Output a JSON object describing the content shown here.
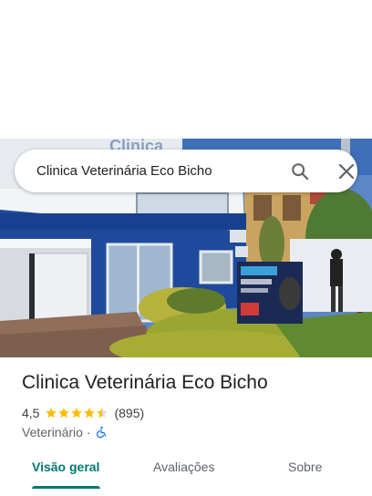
{
  "search": {
    "query": "Clinica Veterinária Eco Bicho"
  },
  "place": {
    "name": "Clinica Veterinária Eco Bicho",
    "rating": "4,5",
    "stars": 4.5,
    "review_count": "(895)",
    "category": "Veterinário",
    "separator": "·",
    "accessibility": "wheelchair-accessible-icon"
  },
  "tabs": [
    {
      "label": "Visão geral",
      "active": true
    },
    {
      "label": "Avaliações",
      "active": false
    },
    {
      "label": "Sobre",
      "active": false
    }
  ],
  "colors": {
    "accent": "#01796f",
    "star": "#fbbc04",
    "accessibility": "#1a73e8"
  },
  "icons": {
    "search": "search-icon",
    "close": "close-icon"
  }
}
